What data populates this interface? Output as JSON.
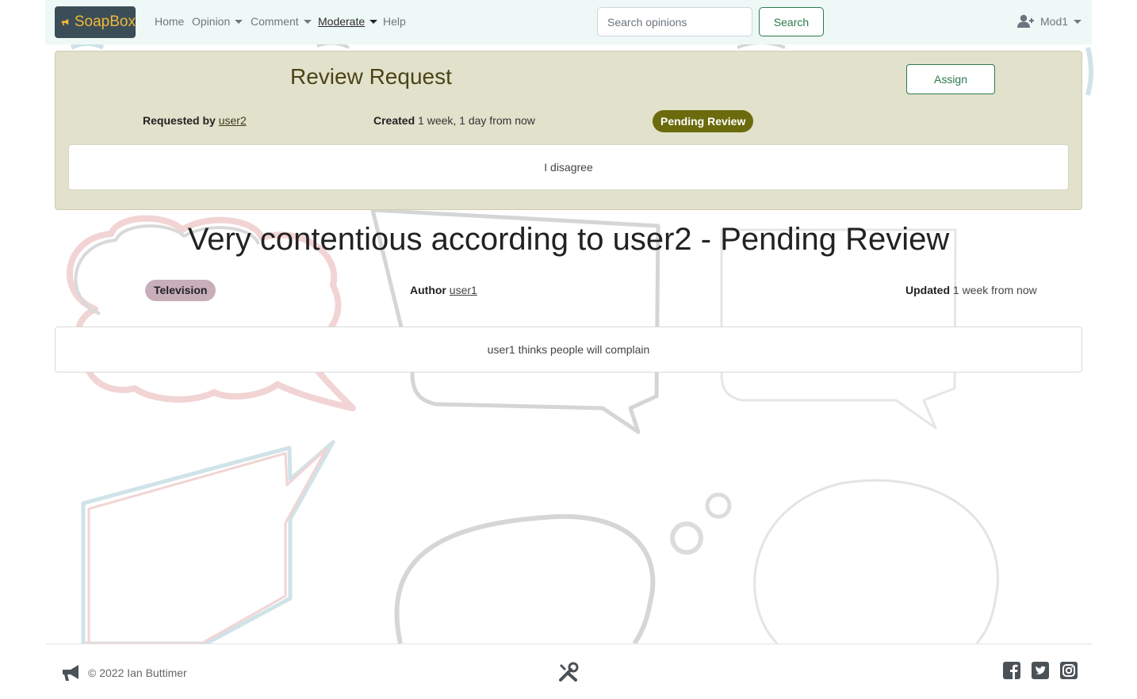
{
  "navbar": {
    "brand": "SoapBox",
    "items": [
      {
        "label": "Home"
      },
      {
        "label": "Opinion"
      },
      {
        "label": "Comment"
      },
      {
        "label": "Moderate"
      },
      {
        "label": "Help"
      }
    ],
    "search_placeholder": "Search opinions",
    "search_button": "Search",
    "user": "Mod1"
  },
  "review": {
    "title": "Review Request",
    "assign_label": "Assign",
    "requested_by_label": "Requested by",
    "requested_by": "user2",
    "created_label": "Created",
    "created": "1 week, 1 day from now",
    "status": "Pending Review",
    "body": "I disagree"
  },
  "opinion": {
    "title": "Very contentious according to user2 - Pending Review",
    "category": "Television",
    "author_label": "Author",
    "author": "user1",
    "updated_label": "Updated",
    "updated": "1 week from now",
    "body": "user1 thinks people will complain"
  },
  "footer": {
    "copyright": "© 2022 Ian Buttimer"
  },
  "colors": {
    "brand_bg": "#3b4e57",
    "brand_text": "#f1b83b",
    "accent_green": "#2c7a4b",
    "status_badge": "#6b6b0d",
    "review_bg": "#e2e1cc",
    "category_pill": "#c7aeb9"
  }
}
